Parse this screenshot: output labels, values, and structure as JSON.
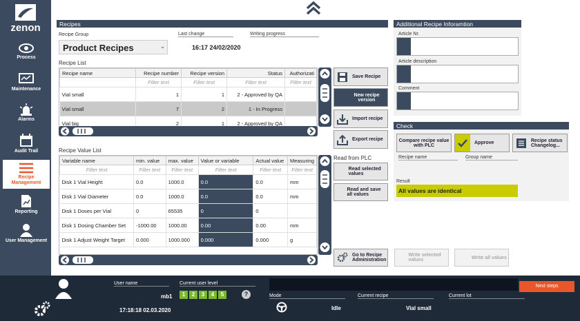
{
  "app": {
    "logo_text": "zenon"
  },
  "sidebar": {
    "items": [
      {
        "label": "Process",
        "icon": "eye-icon"
      },
      {
        "label": "Maintenance",
        "icon": "monitor-icon"
      },
      {
        "label": "Alarms",
        "icon": "alarm-light-icon"
      },
      {
        "label": "Audit Trail",
        "icon": "calendar-icon"
      },
      {
        "label": "Recipe\nManagement",
        "icon": "menu-lines-icon"
      },
      {
        "label": "Reporting",
        "icon": "report-icon"
      },
      {
        "label": "User Management",
        "icon": "user-icon"
      }
    ]
  },
  "recipes": {
    "title": "Recipes",
    "group_label": "Recipe Group",
    "group_value": "Product Recipes",
    "last_change_label": "Last change",
    "last_change_value": "16:17 24/02/2020",
    "writing_progress_label": "Writing progress",
    "list_label": "Recipe List",
    "list_columns": [
      "Recipe name",
      "Recipe number",
      "Recipe version",
      "Status",
      "Authorizati"
    ],
    "filter_text": "Filter text",
    "list_rows": [
      [
        "Vial small",
        "1",
        "1",
        "2 - Approved by QA",
        ""
      ],
      [
        "Vial small",
        "7",
        "2",
        "1 - In Progress",
        ""
      ],
      [
        "Vial big",
        "2",
        "1",
        "2 - Approved by QA",
        ""
      ]
    ],
    "value_list_label": "Recipe Value List",
    "value_columns": [
      "Variable name",
      "min. value",
      "max. value",
      "Value or variable",
      "Actual value",
      "Measuring"
    ],
    "value_rows": [
      [
        "Disk 1 Vial Height",
        "0.0",
        "1000.0",
        "0.0",
        "0.0",
        "mm"
      ],
      [
        "Disk 1 Vial Diameter",
        "0.0",
        "1000.0",
        "0.0",
        "0.0",
        "mm"
      ],
      [
        "Disk 1 Doses per Vial",
        "0",
        "65535",
        "0",
        "0",
        ""
      ],
      [
        "Disk 1 Dosing Chamber Set",
        "-1000.00",
        "1000.00",
        "0.00",
        "0.00",
        "mm"
      ],
      [
        "Disk 1 Adjust Weight Target",
        "0.000",
        "1000.000",
        "0.000",
        "0.000",
        "g"
      ]
    ]
  },
  "buttons": {
    "save": "Save Recipe",
    "new": "New recipe version",
    "import": "Import recipe",
    "export": "Export recipe",
    "read_from_plc": "Read from PLC",
    "read_selected": "Read selected values",
    "read_save_all": "Read and save all values",
    "go_admin": "Go to Recipe Administration",
    "write_selected": "Write selected values",
    "write_all": "Write all values"
  },
  "additional": {
    "title": "Additional Recipe Inforamtion",
    "article_nr_label": "Article Nr.",
    "article_desc_label": "Article description",
    "comment_label": "Comment"
  },
  "check": {
    "title": "Check",
    "compare": "Compare recipe value with PLC",
    "approve": "Approve",
    "status_log": "Recipe status Changelog...",
    "recipe_name_label": "Recipe name",
    "group_name_label": "Group name",
    "result_label": "Result",
    "result_value": "All values are identical"
  },
  "footer": {
    "user_name_label": "User name",
    "user_name_value": "mb1",
    "level_label": "Current user level",
    "levels": [
      "1",
      "2",
      "3",
      "4",
      "5"
    ],
    "help": "?",
    "datetime": "17:18:18 02.03.2020",
    "mode_label": "Mode",
    "mode_value": "Idle",
    "recipe_label": "Current recipe",
    "recipe_value": "Vial small",
    "lot_label": "Current lot",
    "next_steps": "Next steps"
  },
  "colors": {
    "navy": "#3b4a5e",
    "accent": "#e8562a",
    "result": "#c8cc00",
    "level": "#7ab82c"
  }
}
